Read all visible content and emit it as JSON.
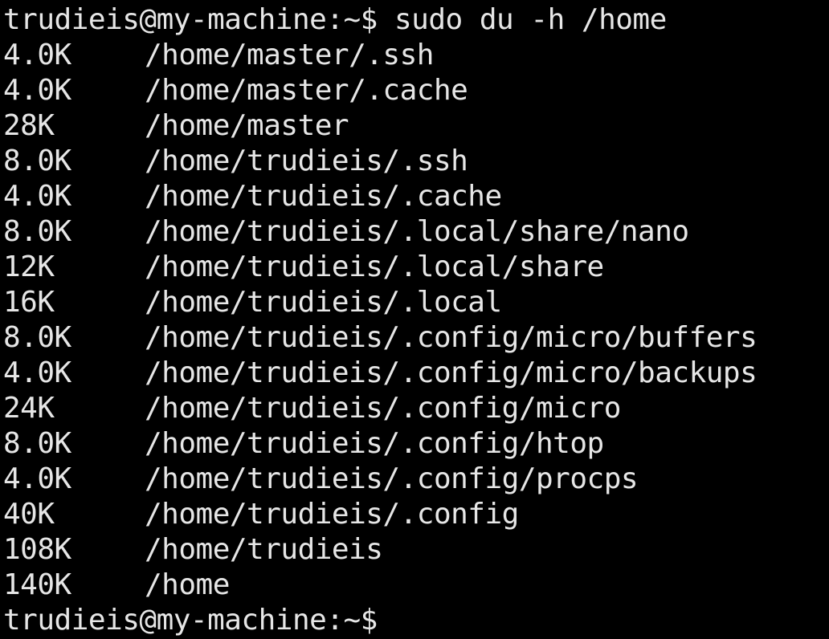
{
  "terminal": {
    "command_prompt": "trudieis@my-machine:~$ sudo du -h /home",
    "rows": [
      {
        "size": "4.0K",
        "path": "/home/master/.ssh"
      },
      {
        "size": "4.0K",
        "path": "/home/master/.cache"
      },
      {
        "size": "28K",
        "path": "/home/master"
      },
      {
        "size": "8.0K",
        "path": "/home/trudieis/.ssh"
      },
      {
        "size": "4.0K",
        "path": "/home/trudieis/.cache"
      },
      {
        "size": "8.0K",
        "path": "/home/trudieis/.local/share/nano"
      },
      {
        "size": "12K",
        "path": "/home/trudieis/.local/share"
      },
      {
        "size": "16K",
        "path": "/home/trudieis/.local"
      },
      {
        "size": "8.0K",
        "path": "/home/trudieis/.config/micro/buffers"
      },
      {
        "size": "4.0K",
        "path": "/home/trudieis/.config/micro/backups"
      },
      {
        "size": "24K",
        "path": "/home/trudieis/.config/micro"
      },
      {
        "size": "8.0K",
        "path": "/home/trudieis/.config/htop"
      },
      {
        "size": "4.0K",
        "path": "/home/trudieis/.config/procps"
      },
      {
        "size": "40K",
        "path": "/home/trudieis/.config"
      },
      {
        "size": "108K",
        "path": "/home/trudieis"
      },
      {
        "size": "140K",
        "path": "/home"
      }
    ],
    "final_prompt": "trudieis@my-machine:~$"
  }
}
